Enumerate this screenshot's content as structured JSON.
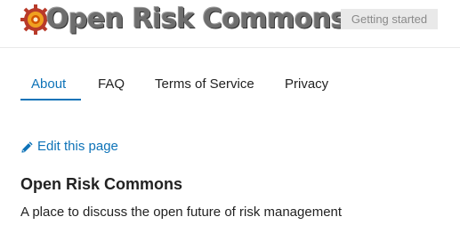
{
  "header": {
    "logo_text": "Open Risk Commons",
    "getting_started_label": "Getting started"
  },
  "nav": {
    "tabs": [
      {
        "label": "About",
        "active": true
      },
      {
        "label": "FAQ",
        "active": false
      },
      {
        "label": "Terms of Service",
        "active": false
      },
      {
        "label": "Privacy",
        "active": false
      }
    ]
  },
  "main": {
    "edit_link_label": "Edit this page",
    "title": "Open Risk Commons",
    "description": "A place to discuss the open future of risk management"
  },
  "colors": {
    "accent": "#0e73b8",
    "button_bg": "#e9e9e9",
    "logo_gear_outer": "#c0392b",
    "logo_gear_inner": "#f39c12"
  },
  "icons": {
    "logo_icon": "gear-icon",
    "edit_icon": "pencil-icon"
  }
}
